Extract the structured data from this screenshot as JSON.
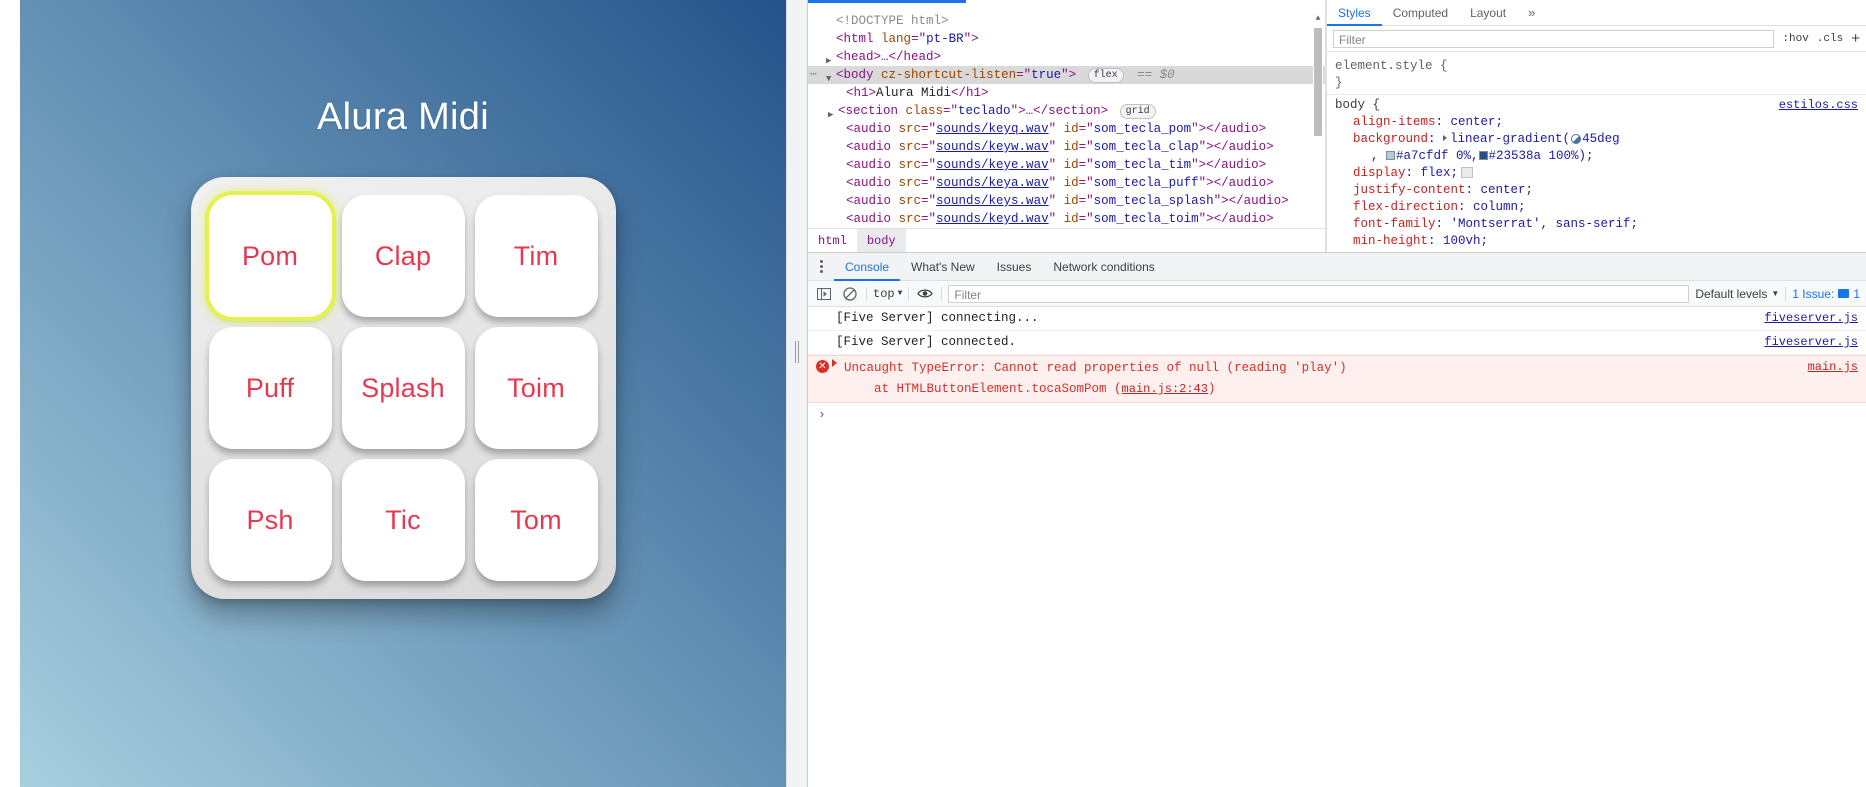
{
  "app": {
    "title": "Alura Midi",
    "keys": [
      {
        "label": "Pom",
        "focused": true
      },
      {
        "label": "Clap",
        "focused": false
      },
      {
        "label": "Tim",
        "focused": false
      },
      {
        "label": "Puff",
        "focused": false
      },
      {
        "label": "Splash",
        "focused": false
      },
      {
        "label": "Toim",
        "focused": false
      },
      {
        "label": "Psh",
        "focused": false
      },
      {
        "label": "Tic",
        "focused": false
      },
      {
        "label": "Tom",
        "focused": false
      }
    ],
    "colors": {
      "bg_start": "#a7cfdf",
      "bg_end": "#23538a",
      "key_text": "#e63950",
      "focus_ring": "#e4f24f"
    }
  },
  "devtools": {
    "elements": {
      "lines": [
        {
          "text": "<!DOCTYPE html>",
          "kind": "doctype"
        },
        {
          "text": "<html lang=\"pt-BR\">",
          "kind": "open"
        },
        {
          "text": "<head>…</head>",
          "kind": "collapsed"
        },
        {
          "text": "<body cz-shortcut-listen=\"true\">",
          "kind": "selected",
          "badge": "flex",
          "suffix": "== $0"
        },
        {
          "text": "<h1>Alura Midi</h1>",
          "kind": "leaf"
        },
        {
          "text": "<section class=\"teclado\">…</section>",
          "kind": "collapsed",
          "badge": "grid"
        },
        {
          "text": "<audio src=\"sounds/keyq.wav\" id=\"som_tecla_pom\"></audio>",
          "kind": "leaf"
        },
        {
          "text": "<audio src=\"sounds/keyw.wav\" id=\"som_tecla_clap\"></audio>",
          "kind": "leaf"
        },
        {
          "text": "<audio src=\"sounds/keye.wav\" id=\"som_tecla_tim\"></audio>",
          "kind": "leaf"
        },
        {
          "text": "<audio src=\"sounds/keya.wav\" id=\"som_tecla_puff\"></audio>",
          "kind": "leaf"
        },
        {
          "text": "<audio src=\"sounds/keys.wav\" id=\"som_tecla_splash\"></audio>",
          "kind": "leaf"
        },
        {
          "text": "<audio src=\"sounds/keyd.wav\" id=\"som_tecla_toim\"></audio>",
          "kind": "leaf"
        }
      ],
      "dom": {
        "doctype": "<!DOCTYPE html>",
        "html_tag": "html",
        "html_attr_name": "lang",
        "html_attr_value": "pt-BR",
        "head_collapsed": "<head>…</head>",
        "body_tag": "body",
        "body_attr_name": "cz-shortcut-listen",
        "body_attr_value": "true",
        "body_badge": "flex",
        "body_selected_marker": "== $0",
        "h1_text": "Alura Midi",
        "section_attr_name": "class",
        "section_attr_value": "teclado",
        "section_badge": "grid",
        "audios": [
          {
            "src": "sounds/keyq.wav",
            "id": "som_tecla_pom"
          },
          {
            "src": "sounds/keyw.wav",
            "id": "som_tecla_clap"
          },
          {
            "src": "sounds/keye.wav",
            "id": "som_tecla_tim"
          },
          {
            "src": "sounds/keya.wav",
            "id": "som_tecla_puff"
          },
          {
            "src": "sounds/keys.wav",
            "id": "som_tecla_splash"
          },
          {
            "src": "sounds/keyd.wav",
            "id": "som_tecla_toim"
          }
        ]
      },
      "breadcrumb": [
        "html",
        "body"
      ]
    },
    "styles": {
      "tabs": [
        "Styles",
        "Computed",
        "Layout"
      ],
      "more_label": "»",
      "active_tab": "Styles",
      "filter_placeholder": "Filter",
      "hov_label": ":hov",
      "cls_label": ".cls",
      "plus_label": "+",
      "element_style_selector": "element.style {",
      "element_style_close": "}",
      "body_selector": "body {",
      "body_origin": "estilos.css",
      "declarations": [
        {
          "name": "align-items",
          "value": "center;"
        },
        {
          "name": "background",
          "value": "linear-gradient(45deg, #a7cfdf 0%, #23538a 100%);",
          "has_gradient": true
        },
        {
          "name": "display",
          "value": "flex;",
          "has_flex_badge": true
        },
        {
          "name": "justify-content",
          "value": "center;"
        },
        {
          "name": "flex-direction",
          "value": "column;"
        },
        {
          "name": "font-family",
          "value": "'Montserrat', sans-serif;"
        },
        {
          "name": "min-height",
          "value": "100vh;"
        }
      ],
      "gradient_angle": "45deg",
      "gradient_stop1": "#a7cfdf 0%,",
      "gradient_stop2": "#23538a 100%);",
      "gradient_stop1_color": "#a7cfdf",
      "gradient_stop2_color": "#23538a"
    },
    "drawer": {
      "tabs": [
        "Console",
        "What's New",
        "Issues",
        "Network conditions"
      ],
      "active_tab": "Console",
      "toolbar": {
        "context": "top",
        "filter_placeholder": "Filter",
        "levels_label": "Default levels",
        "issues_label": "1 Issue:",
        "issues_count": "1"
      },
      "messages": [
        {
          "text": "[Five Server] connecting...",
          "source": "fiveserver.js",
          "type": "log"
        },
        {
          "text": "[Five Server] connected.",
          "source": "fiveserver.js",
          "type": "log"
        },
        {
          "text": "Uncaught TypeError: Cannot read properties of null (reading 'play')",
          "stack": "at HTMLButtonElement.tocaSomPom (main.js:2:43)",
          "stack_prefix": "at HTMLButtonElement.tocaSomPom (",
          "stack_link": "main.js:2:43",
          "stack_suffix": ")",
          "source": "main.js",
          "type": "error"
        }
      ]
    }
  }
}
